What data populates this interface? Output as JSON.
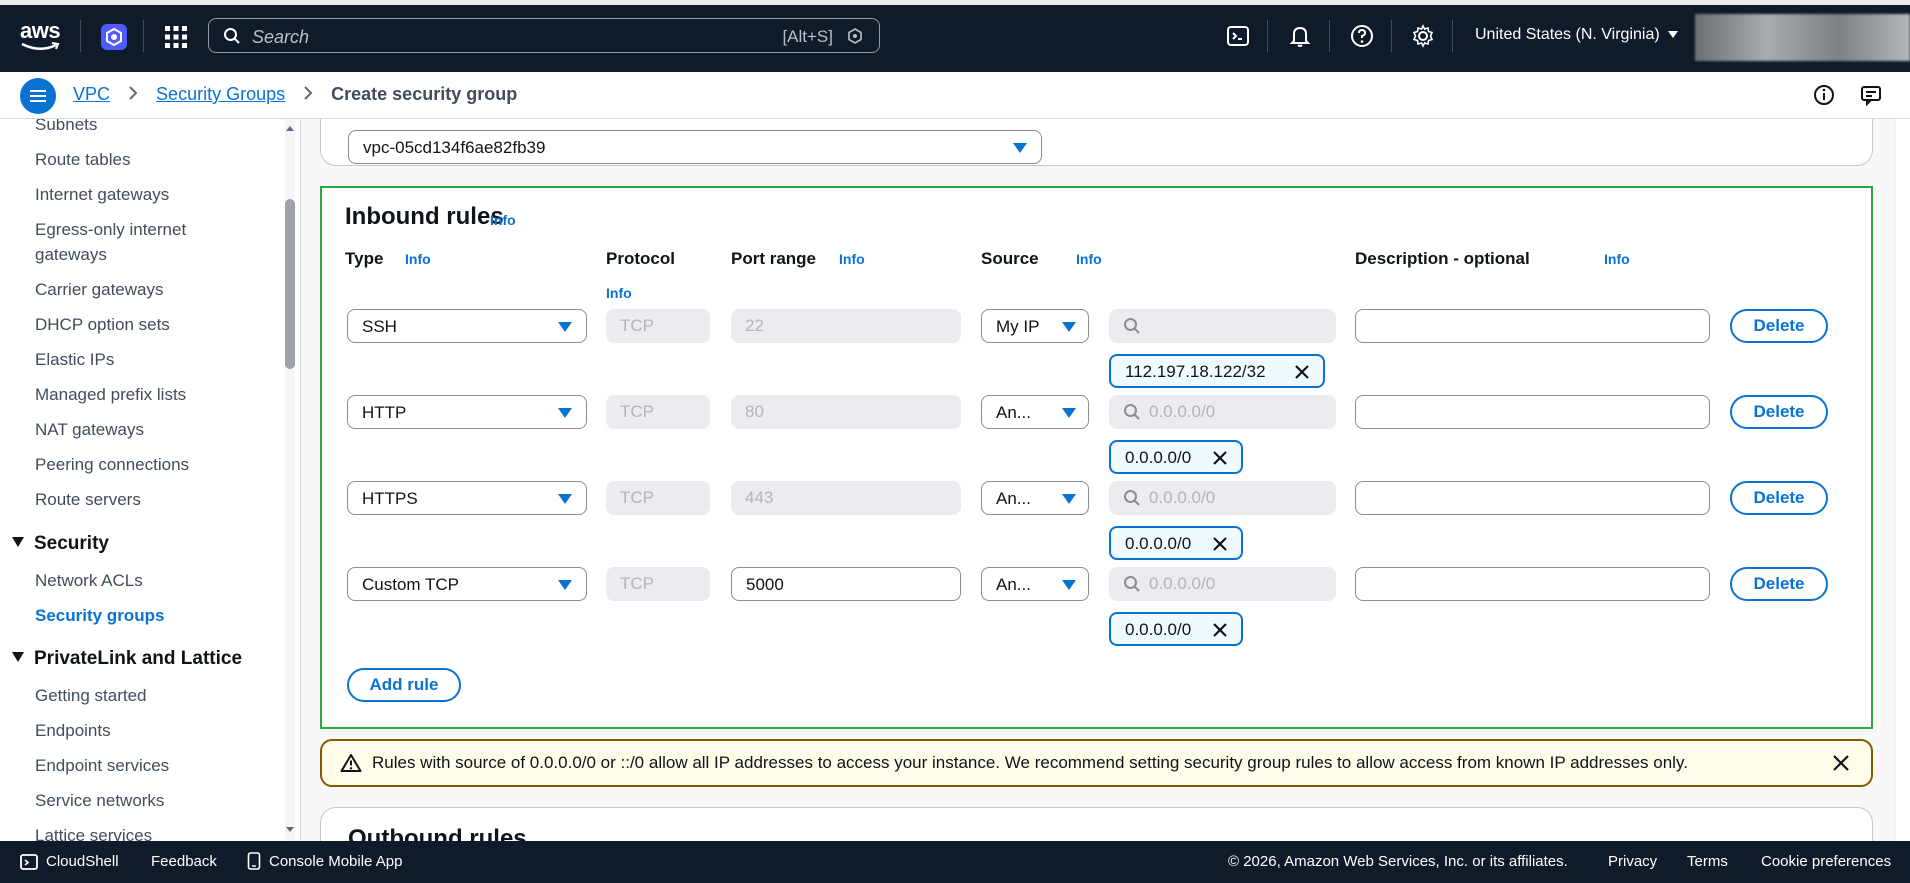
{
  "topnav": {
    "logo": "aws",
    "search_placeholder": "Search",
    "search_shortcut": "[Alt+S]",
    "region": "United States (N. Virginia)",
    "icons": [
      "cloudshell-icon",
      "bell-icon",
      "help-icon",
      "gear-icon"
    ]
  },
  "breadcrumb": {
    "items": [
      "VPC",
      "Security Groups"
    ],
    "current": "Create security group"
  },
  "sidebar": {
    "items_top": [
      "Subnets",
      "Route tables",
      "Internet gateways",
      "Egress-only internet gateways",
      "Carrier gateways",
      "DHCP option sets",
      "Elastic IPs",
      "Managed prefix lists",
      "NAT gateways",
      "Peering connections",
      "Route servers"
    ],
    "section_security": "Security",
    "items_security": [
      "Network ACLs",
      "Security groups"
    ],
    "section_privatelink": "PrivateLink and Lattice",
    "items_privatelink": [
      "Getting started",
      "Endpoints",
      "Endpoint services",
      "Service networks",
      "Lattice services"
    ]
  },
  "vpc_select": {
    "value": "vpc-05cd134f6ae82fb39"
  },
  "inbound": {
    "title": "Inbound rules",
    "info": "Info",
    "headers": {
      "type": "Type",
      "protocol": "Protocol",
      "port_range": "Port range",
      "source": "Source",
      "description": "Description - optional"
    },
    "rules": [
      {
        "type": "SSH",
        "protocol": "TCP",
        "port": "22",
        "source": "My IP",
        "search": "",
        "token": "112.197.18.122/32",
        "description": "",
        "delete": "Delete"
      },
      {
        "type": "HTTP",
        "protocol": "TCP",
        "port": "80",
        "source": "An...",
        "search": "0.0.0.0/0",
        "token": "0.0.0.0/0",
        "description": "",
        "delete": "Delete"
      },
      {
        "type": "HTTPS",
        "protocol": "TCP",
        "port": "443",
        "source": "An...",
        "search": "0.0.0.0/0",
        "token": "0.0.0.0/0",
        "description": "",
        "delete": "Delete"
      },
      {
        "type": "Custom TCP",
        "protocol": "TCP",
        "port": "5000",
        "source": "An...",
        "search": "0.0.0.0/0",
        "token": "0.0.0.0/0",
        "description": "",
        "delete": "Delete"
      }
    ],
    "add_rule": "Add rule"
  },
  "warning": {
    "text": "Rules with source of 0.0.0.0/0 or ::/0 allow all IP addresses to access your instance. We recommend setting security group rules to allow access from known IP addresses only."
  },
  "outbound": {
    "title": "Outbound rules"
  },
  "footer": {
    "cloudshell": "CloudShell",
    "feedback": "Feedback",
    "mobile_app": "Console Mobile App",
    "copyright": "© 2026, Amazon Web Services, Inc. or its affiliates.",
    "privacy": "Privacy",
    "terms": "Terms",
    "cookie": "Cookie preferences"
  },
  "colors": {
    "nav_bg": "#0f1b2a",
    "accent": "#0972d3",
    "highlight_border": "#28a745",
    "warning_border": "#855900",
    "warning_bg": "#fffce9"
  }
}
